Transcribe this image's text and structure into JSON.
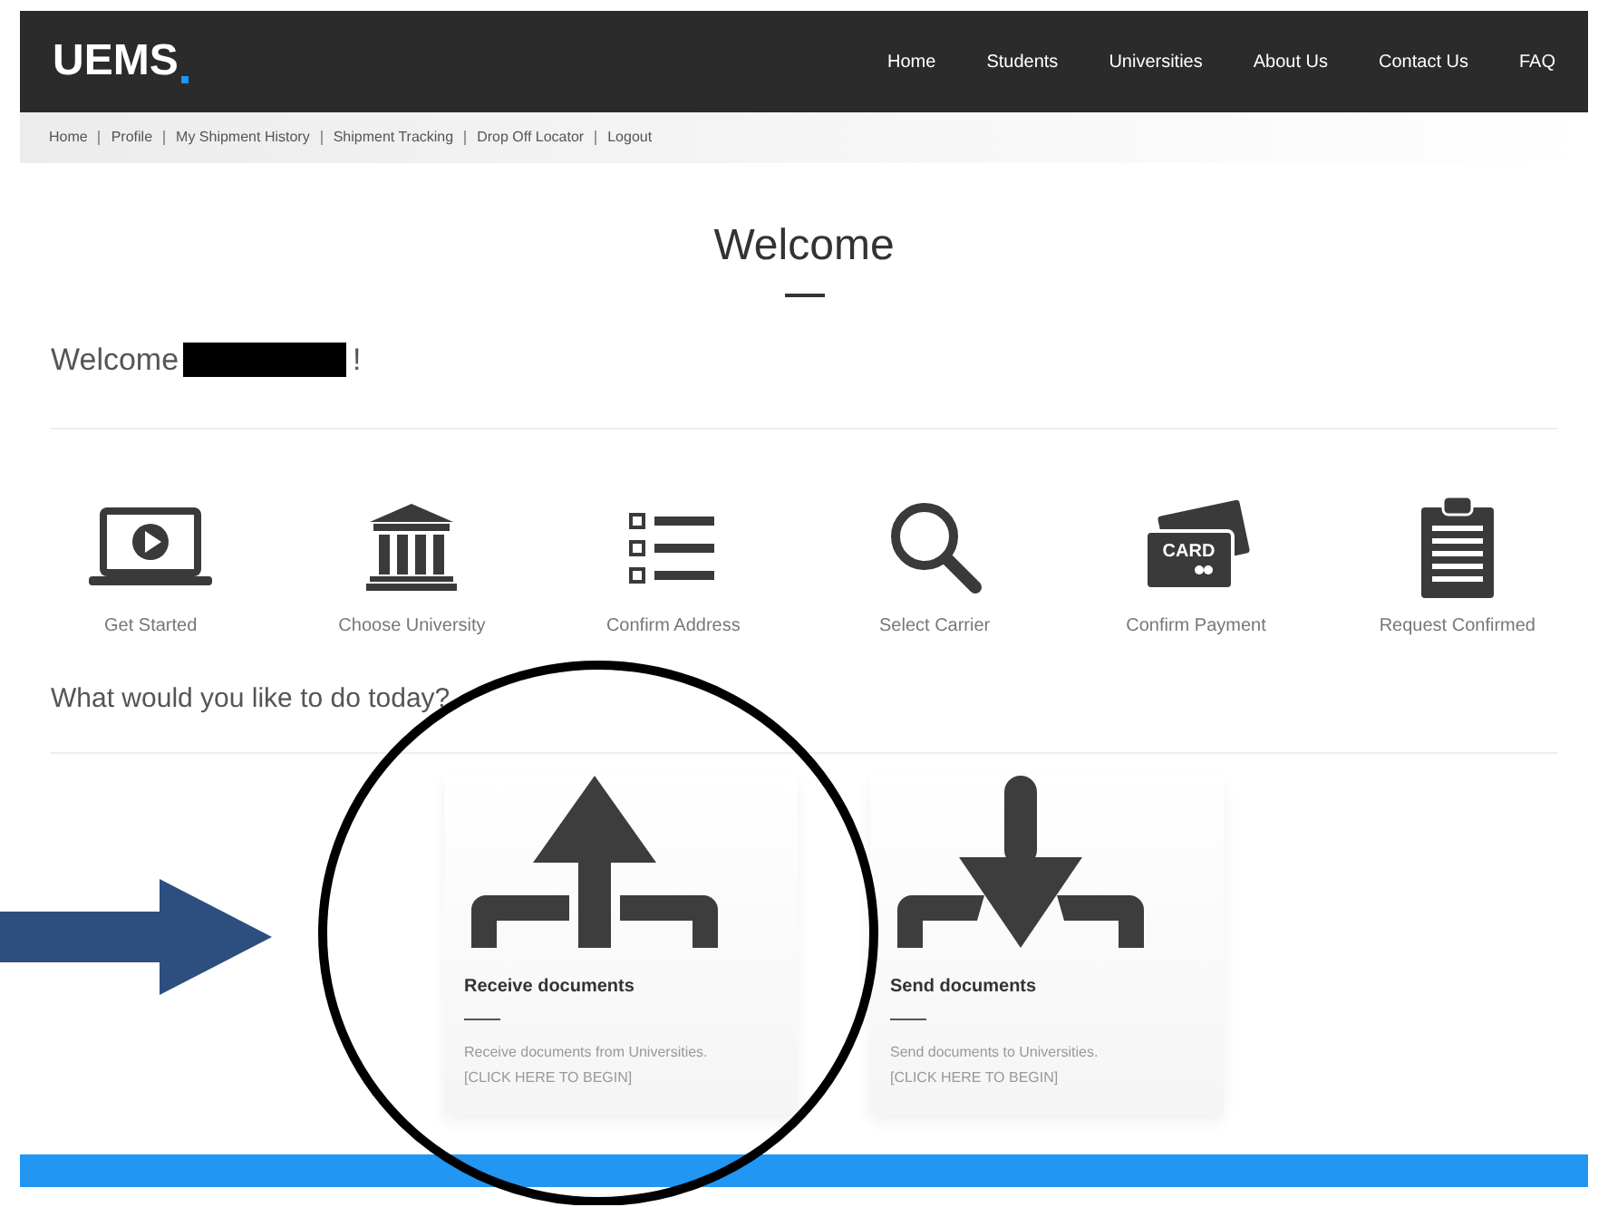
{
  "header": {
    "logo": "UEMS",
    "nav": [
      {
        "label": "Home"
      },
      {
        "label": "Students"
      },
      {
        "label": "Universities"
      },
      {
        "label": "About Us"
      },
      {
        "label": "Contact Us"
      },
      {
        "label": "FAQ"
      }
    ]
  },
  "breadcrumb": [
    {
      "label": "Home"
    },
    {
      "label": "Profile"
    },
    {
      "label": "My Shipment History"
    },
    {
      "label": "Shipment Tracking"
    },
    {
      "label": "Drop Off Locator"
    },
    {
      "label": "Logout"
    }
  ],
  "title": "Welcome",
  "greeting": {
    "prefix": "Welcome",
    "suffix": "!"
  },
  "steps": [
    {
      "kind": "video",
      "label": "Get Started"
    },
    {
      "kind": "bank",
      "label": "Choose University"
    },
    {
      "kind": "list",
      "label": "Confirm Address"
    },
    {
      "kind": "search",
      "label": "Select Carrier"
    },
    {
      "kind": "card",
      "label": "Confirm Payment",
      "badge": "CARD"
    },
    {
      "kind": "clipboard",
      "label": "Request Confirmed"
    }
  ],
  "question": "What would you like to do today?",
  "cards": [
    {
      "kind": "up",
      "title": "Receive documents",
      "description": "Receive documents from Universities.",
      "cta": "[CLICK HERE TO BEGIN]"
    },
    {
      "kind": "down",
      "title": "Send documents",
      "description": "Send documents to Universities.",
      "cta": "[CLICK HERE TO BEGIN]"
    }
  ]
}
